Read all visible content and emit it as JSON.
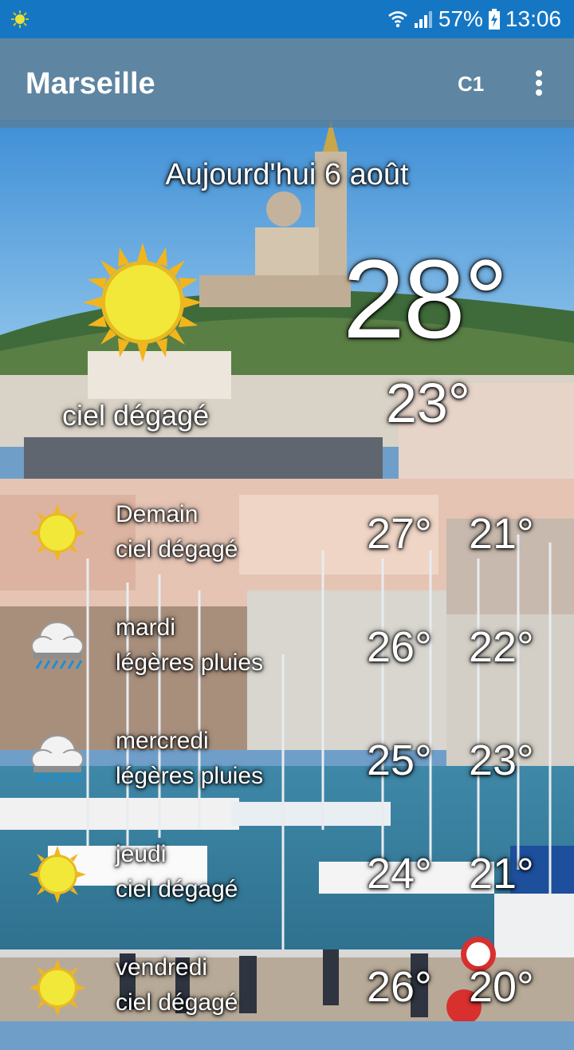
{
  "status_bar": {
    "battery": "57%",
    "time": "13:06",
    "icons": [
      "notification-sun-icon",
      "wifi-icon",
      "signal-icon",
      "battery-charging-icon"
    ]
  },
  "app_bar": {
    "title": "Marseille",
    "unit_button": "C1",
    "menu_icon": "more-vert-icon"
  },
  "today": {
    "date": "Aujourd'hui 6 août",
    "icon": "sun-icon",
    "temp_max": "28°",
    "temp_min": "23°",
    "condition": "ciel dégagé"
  },
  "forecast": [
    {
      "day": "Demain",
      "condition": "ciel dégagé",
      "max": "27°",
      "min": "21°",
      "icon": "sun-icon"
    },
    {
      "day": "mardi",
      "condition": "légères pluies",
      "max": "26°",
      "min": "22°",
      "icon": "rain-cloud-icon"
    },
    {
      "day": "mercredi",
      "condition": "légères pluies",
      "max": "25°",
      "min": "23°",
      "icon": "rain-cloud-icon"
    },
    {
      "day": "jeudi",
      "condition": "ciel dégagé",
      "max": "24°",
      "min": "21°",
      "icon": "sun-icon"
    },
    {
      "day": "vendredi",
      "condition": "ciel dégagé",
      "max": "26°",
      "min": "20°",
      "icon": "sun-icon"
    }
  ],
  "colors": {
    "status_bar": "#1577c4",
    "app_bar": "#5a7d96",
    "sun": "#f1e83a",
    "sun_rays": "#f2b51c"
  }
}
